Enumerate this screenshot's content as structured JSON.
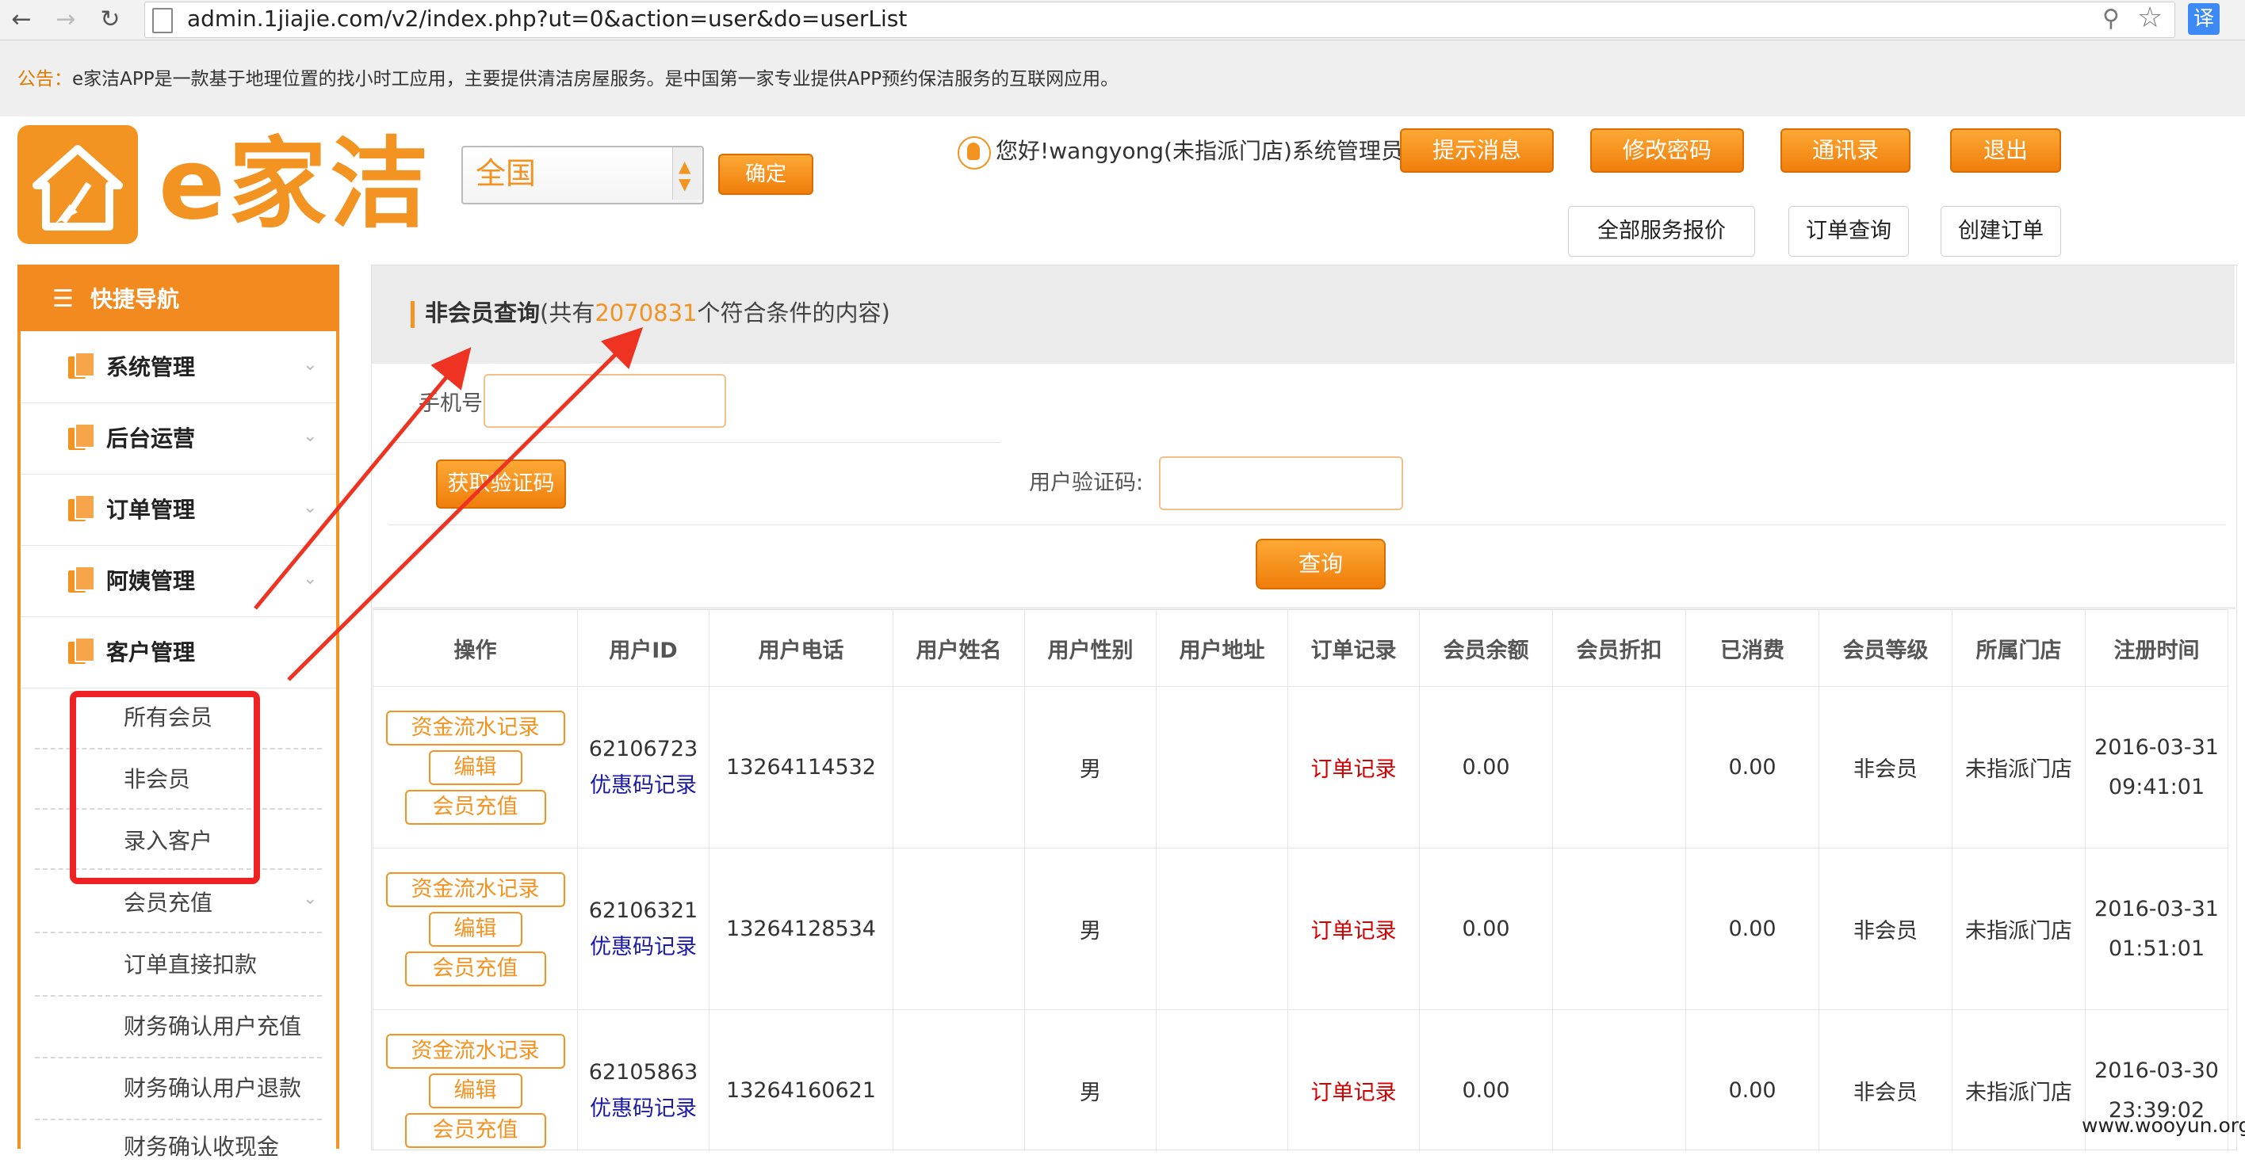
{
  "browser": {
    "url": "admin.1jiajie.com/v2/index.php?ut=0&action=user&do=userList",
    "back_icon": "arrow-left-icon",
    "forward_icon": "arrow-right-icon",
    "reload_icon": "reload-icon",
    "translate_label": "译"
  },
  "notice": {
    "label": "公告：",
    "text": "e家洁APP是一款基于地理位置的找小时工应用，主要提供清洁房屋服务。是中国第一家专业提供APP预约保洁服务的互联网应用。"
  },
  "header": {
    "logo_text": "e家洁",
    "region_value": "全国",
    "confirm_label": "确定",
    "greeting": "您好!wangyong(未指派门店)系统管理员",
    "buttons": {
      "notify": "提示消息",
      "password": "修改密码",
      "contacts": "通讯录",
      "logout": "退出"
    },
    "secondary": {
      "pricelist": "全部服务报价",
      "orderquery": "订单查询",
      "createorder": "创建订单"
    },
    "accent_color": "#f39321"
  },
  "sidebar": {
    "title": "快捷导航",
    "menus": [
      {
        "label": "系统管理"
      },
      {
        "label": "后台运营"
      },
      {
        "label": "订单管理"
      },
      {
        "label": "阿姨管理"
      },
      {
        "label": "客户管理"
      }
    ],
    "sub_items": [
      {
        "label": "所有会员"
      },
      {
        "label": "非会员"
      },
      {
        "label": "录入客户"
      },
      {
        "label": "会员充值"
      },
      {
        "label": "订单直接扣款"
      },
      {
        "label": "财务确认用户充值"
      },
      {
        "label": "财务确认用户退款"
      },
      {
        "label": "财务确认收现金"
      }
    ]
  },
  "panel": {
    "title": "非会员查询",
    "count_prefix": "(共有",
    "count": "2070831",
    "count_suffix": "个符合条件的内容)",
    "phone_label": "手机号",
    "phone_value": "",
    "get_code_label": "获取验证码",
    "code_label": "用户验证码:",
    "code_value": "",
    "query_label": "查询"
  },
  "table": {
    "headers": [
      "操作",
      "用户ID",
      "用户电话",
      "用户姓名",
      "用户性别",
      "用户地址",
      "订单记录",
      "会员余额",
      "会员折扣",
      "已消费",
      "会员等级",
      "所属门店",
      "注册时间"
    ],
    "op_labels": {
      "flow": "资金流水记录",
      "edit": "编辑",
      "charge": "会员充值"
    },
    "coupon_label": "优惠码记录",
    "order_label": "订单记录",
    "rows": [
      {
        "id": "62106723",
        "phone": "13264114532",
        "name": "",
        "gender": "男",
        "address": "",
        "balance": "0.00",
        "discount": "",
        "spent": "0.00",
        "level": "非会员",
        "store": "未指派门店",
        "reg_time": "2016-03-31 09:41:01"
      },
      {
        "id": "62106321",
        "phone": "13264128534",
        "name": "",
        "gender": "男",
        "address": "",
        "balance": "0.00",
        "discount": "",
        "spent": "0.00",
        "level": "非会员",
        "store": "未指派门店",
        "reg_time": "2016-03-31 01:51:01"
      },
      {
        "id": "62105863",
        "phone": "13264160621",
        "name": "",
        "gender": "男",
        "address": "",
        "balance": "0.00",
        "discount": "",
        "spent": "0.00",
        "level": "非会员",
        "store": "未指派门店",
        "reg_time": "2016-03-30 23:39:02"
      }
    ]
  },
  "watermark": "www.wooyun.org"
}
